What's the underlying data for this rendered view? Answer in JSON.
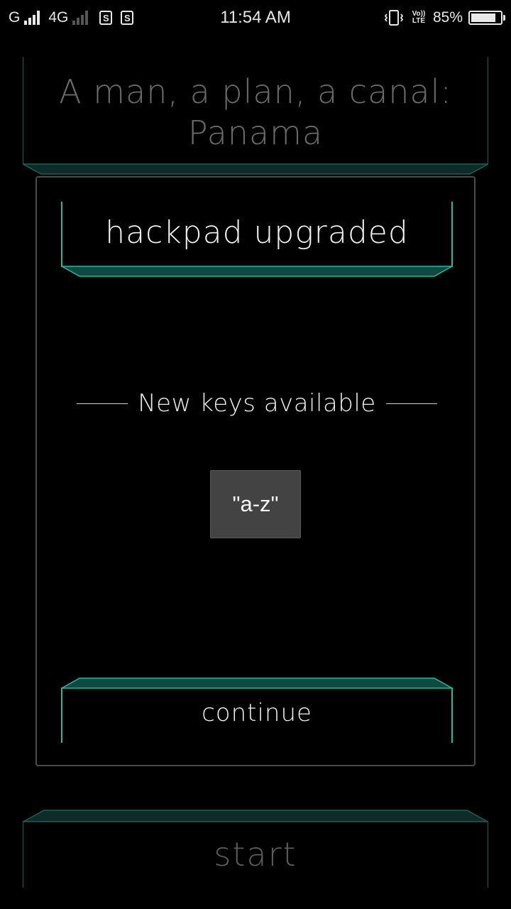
{
  "status_bar": {
    "carrier1": "G",
    "network": "4G",
    "time": "11:54 AM",
    "volte": "Vo)) LTE",
    "battery_percent": "85%",
    "battery_level": 0.85,
    "sim1_badge": "S",
    "sim2_badge": "S"
  },
  "puzzle": {
    "text": "A man, a plan, a canal: Panama"
  },
  "dialog": {
    "title": "hackpad upgraded",
    "section_label": "New keys available",
    "keys": [
      "\"a-z\""
    ],
    "continue_label": "continue"
  },
  "start_label": "start",
  "colors": {
    "accent": "#2fb5a0",
    "accent_dim": "#1f5e56",
    "key_chip_bg": "#434343"
  }
}
